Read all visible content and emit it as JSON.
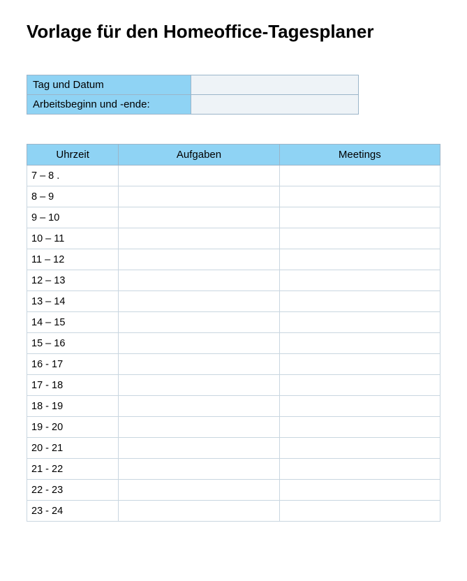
{
  "title": "Vorlage für den Homeoffice-Tagesplaner",
  "info": {
    "rows": [
      {
        "label": "Tag und Datum",
        "value": ""
      },
      {
        "label": "Arbeitsbeginn und -ende:",
        "value": ""
      }
    ]
  },
  "schedule": {
    "headers": {
      "time": "Uhrzeit",
      "tasks": "Aufgaben",
      "meetings": "Meetings"
    },
    "rows": [
      {
        "time": "7 – 8 .",
        "tasks": "",
        "meetings": ""
      },
      {
        "time": "8 – 9",
        "tasks": "",
        "meetings": ""
      },
      {
        "time": "9 – 10",
        "tasks": "",
        "meetings": ""
      },
      {
        "time": "10 – 11",
        "tasks": "",
        "meetings": ""
      },
      {
        "time": "11 – 12",
        "tasks": "",
        "meetings": ""
      },
      {
        "time": "12 – 13",
        "tasks": "",
        "meetings": ""
      },
      {
        "time": "13 – 14",
        "tasks": "",
        "meetings": ""
      },
      {
        "time": "14 – 15",
        "tasks": "",
        "meetings": ""
      },
      {
        "time": "15 – 16",
        "tasks": "",
        "meetings": ""
      },
      {
        "time": "16 - 17",
        "tasks": "",
        "meetings": ""
      },
      {
        "time": "17 - 18",
        "tasks": "",
        "meetings": ""
      },
      {
        "time": "18 - 19",
        "tasks": "",
        "meetings": ""
      },
      {
        "time": "19 - 20",
        "tasks": "",
        "meetings": ""
      },
      {
        "time": "20 - 21",
        "tasks": "",
        "meetings": ""
      },
      {
        "time": "21 - 22",
        "tasks": "",
        "meetings": ""
      },
      {
        "time": "22 - 23",
        "tasks": "",
        "meetings": ""
      },
      {
        "time": "23 - 24",
        "tasks": "",
        "meetings": ""
      }
    ]
  }
}
